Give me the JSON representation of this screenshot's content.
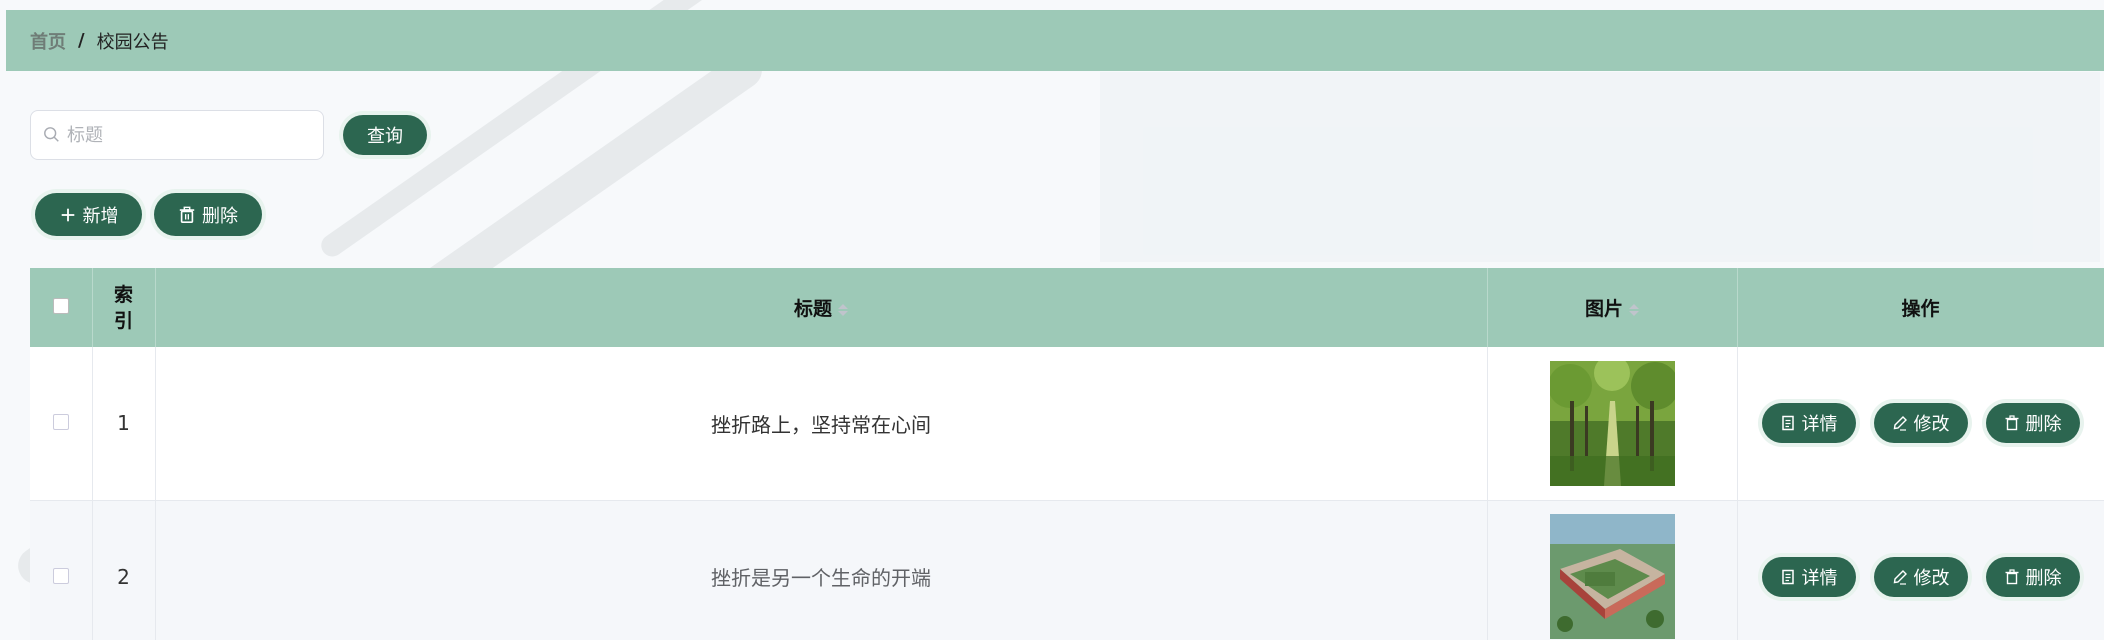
{
  "breadcrumb": {
    "home": "首页",
    "separator": "/",
    "current": "校园公告"
  },
  "search": {
    "placeholder": "标题",
    "value": "",
    "button_label": "查询"
  },
  "toolbar": {
    "add_label": "新增",
    "delete_label": "删除"
  },
  "table": {
    "headers": {
      "index": "索引",
      "title": "标题",
      "image": "图片",
      "actions": "操作"
    },
    "rows": [
      {
        "index": "1",
        "title": "挫折路上，坚持常在心间",
        "image": "tree-lined-path-photo"
      },
      {
        "index": "2",
        "title": "挫折是另一个生命的开端",
        "image": "campus-aerial-view-photo"
      }
    ],
    "row_actions": {
      "detail": "详情",
      "edit": "修改",
      "delete": "删除"
    }
  },
  "colors": {
    "header_bg": "#9dc9b7",
    "button_bg": "#2c6650",
    "row_alt_bg": "#f5f7fa"
  }
}
